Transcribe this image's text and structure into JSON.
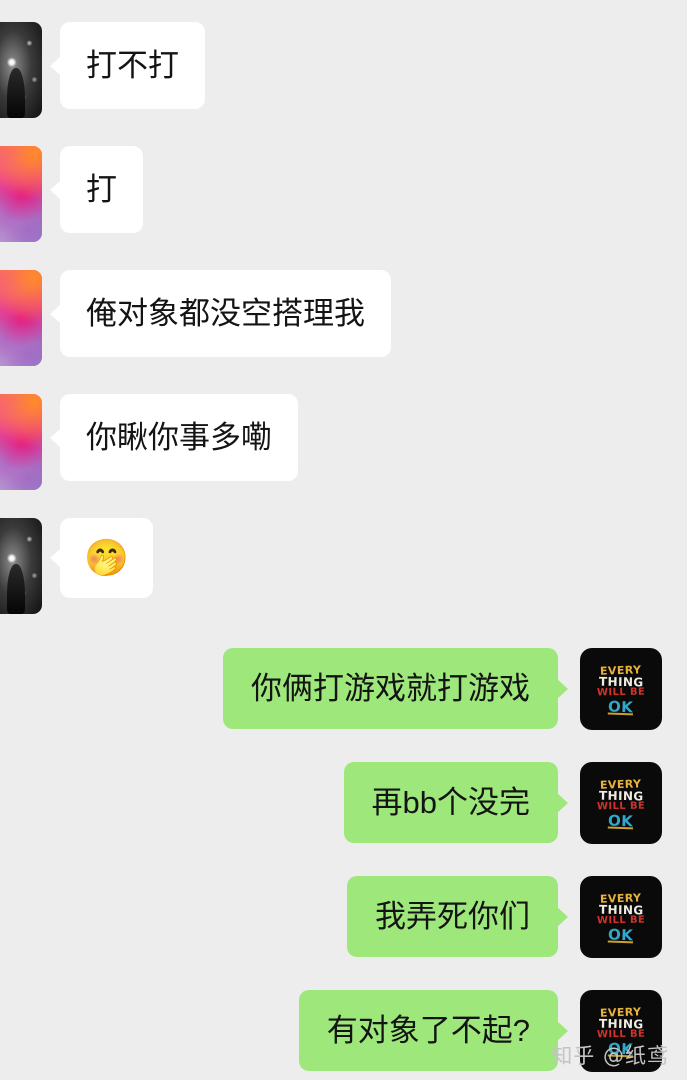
{
  "app": {
    "type": "chat-conversation",
    "background_color": "#ededed",
    "incoming_bubble_color": "#ffffff",
    "outgoing_bubble_color": "#9ee87b",
    "text_color": "#141414"
  },
  "avatars": {
    "dark_star": "dark-starry-figure-avatar",
    "pink_cloud": "pink-orange-cloud-avatar",
    "ok_badge": {
      "name": "everything-will-be-ok-avatar",
      "line1": "EVERY",
      "line2": "THING",
      "line3": "WILL BE",
      "line4": "OK",
      "background": "#0a0a0a"
    }
  },
  "messages": [
    {
      "id": 1,
      "side": "incoming",
      "avatar": "dark_star",
      "type": "text",
      "text": "打不打"
    },
    {
      "id": 2,
      "side": "incoming",
      "avatar": "pink_cloud",
      "type": "text",
      "text": "打"
    },
    {
      "id": 3,
      "side": "incoming",
      "avatar": "pink_cloud",
      "type": "text",
      "text": "俺对象都没空搭理我"
    },
    {
      "id": 4,
      "side": "incoming",
      "avatar": "pink_cloud",
      "type": "text",
      "text": "你瞅你事多嘞"
    },
    {
      "id": 5,
      "side": "incoming",
      "avatar": "dark_star",
      "type": "emoji",
      "text": "🤭"
    },
    {
      "id": 6,
      "side": "outgoing",
      "avatar": "ok_badge",
      "type": "text",
      "text": "你俩打游戏就打游戏"
    },
    {
      "id": 7,
      "side": "outgoing",
      "avatar": "ok_badge",
      "type": "text",
      "text": "再bb个没完"
    },
    {
      "id": 8,
      "side": "outgoing",
      "avatar": "ok_badge",
      "type": "text",
      "text": "我弄死你们"
    },
    {
      "id": 9,
      "side": "outgoing",
      "avatar": "ok_badge",
      "type": "text",
      "text": "有对象了不起?"
    }
  ],
  "watermark": {
    "text": "知乎 @纸鸢",
    "color": "#c3c3c3"
  }
}
